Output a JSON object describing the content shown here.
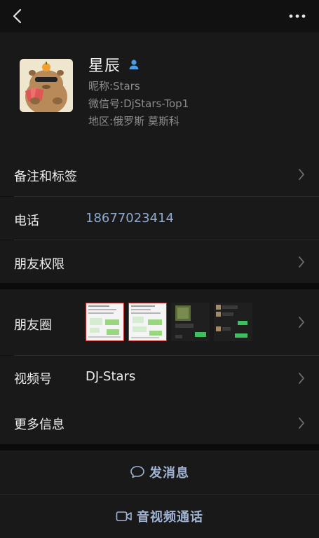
{
  "contact": {
    "name": "星辰",
    "nickname_label": "昵称:",
    "nickname": "Stars",
    "wechat_id_label": "微信号:",
    "wechat_id": "DjStars-Top1",
    "region_label": "地区:",
    "region": "俄罗斯 莫斯科"
  },
  "rows": {
    "remark_label": "备注和标签",
    "phone_label": "电话",
    "phone_value": "18677023414",
    "permissions_label": "朋友权限",
    "moments_label": "朋友圈",
    "channels_label": "视频号",
    "channels_value": "DJ-Stars",
    "more_label": "更多信息"
  },
  "actions": {
    "message_label": "发消息",
    "call_label": "音视频通话"
  },
  "colors": {
    "link": "#8ea9cc",
    "action": "#9fb3d4",
    "bg": "#111111",
    "cell": "#191919"
  }
}
